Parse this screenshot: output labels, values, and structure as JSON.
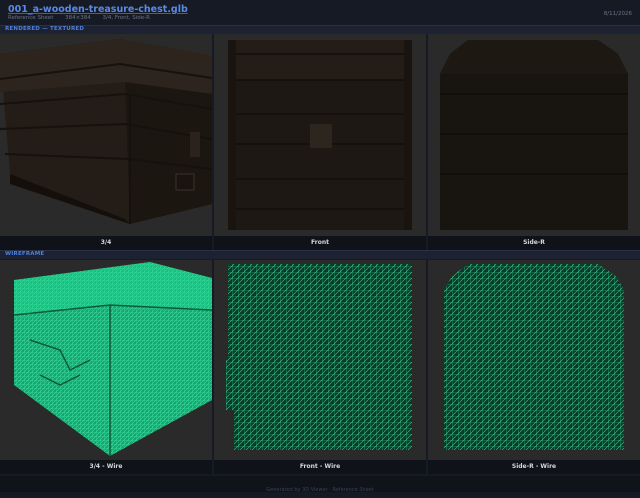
{
  "header": {
    "title": "001_a-wooden-treasure-chest.glb",
    "subtitle_sheet": "Reference Sheet",
    "subtitle_size": "384×384",
    "subtitle_views": "3/4, Front, Side-R",
    "date": "8/11/2026"
  },
  "sections": {
    "rendered": "RENDERED — TEXTURED",
    "wireframe": "WIREFRAME"
  },
  "views": {
    "rendered": [
      "3/4",
      "Front",
      "Side-R"
    ],
    "wireframe": [
      "3/4 - Wire",
      "Front - Wire",
      "Side-R - Wire"
    ]
  },
  "footer": "Generated by 3D Viewer · Reference Sheet",
  "colors": {
    "accent": "#5a8ae8",
    "wire": "#22d391",
    "panel_bg": "#2b2b2b"
  }
}
